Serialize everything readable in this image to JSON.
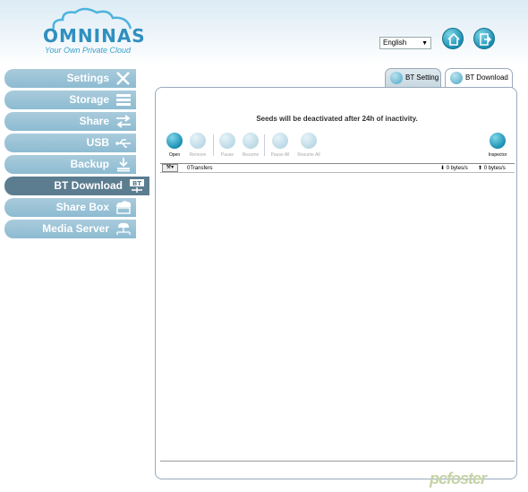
{
  "header": {
    "logo_text": "OMNINAS",
    "logo_tagline": "Your Own Private Cloud",
    "language_selected": "English",
    "home_icon": "home-icon",
    "logout_icon": "logout-icon"
  },
  "sidebar": {
    "items": [
      {
        "label": "Settings",
        "icon": "tools-icon",
        "active": false
      },
      {
        "label": "Storage",
        "icon": "storage-icon",
        "active": false
      },
      {
        "label": "Share",
        "icon": "share-arrows-icon",
        "active": false
      },
      {
        "label": "USB",
        "icon": "usb-icon",
        "active": false
      },
      {
        "label": "Backup",
        "icon": "backup-icon",
        "active": false
      },
      {
        "label": "BT Download",
        "icon": "bt-download-icon",
        "active": true
      },
      {
        "label": "Share Box",
        "icon": "share-box-icon",
        "active": false
      },
      {
        "label": "Media Server",
        "icon": "media-server-icon",
        "active": false
      }
    ]
  },
  "tabs": {
    "setting_label": "BT Setting",
    "download_label": "BT Download"
  },
  "main": {
    "notice": "Seeds will be deactivated after 24h of inactivity.",
    "toolbar": {
      "open": "Open",
      "remove": "Remove",
      "pause": "Pause",
      "resume": "Resume",
      "pause_all": "Pause All",
      "resume_all": "Resume All",
      "inspector": "Inspector"
    },
    "status": {
      "transfers": "0Transfers",
      "download_rate": "0 bytes/s",
      "upload_rate": "0 bytes/s"
    }
  },
  "colors": {
    "accent": "#1b8fb3",
    "sidebar_item": "#a9cbdc",
    "sidebar_active": "#5b7d8f"
  },
  "watermark": "pcfoster"
}
